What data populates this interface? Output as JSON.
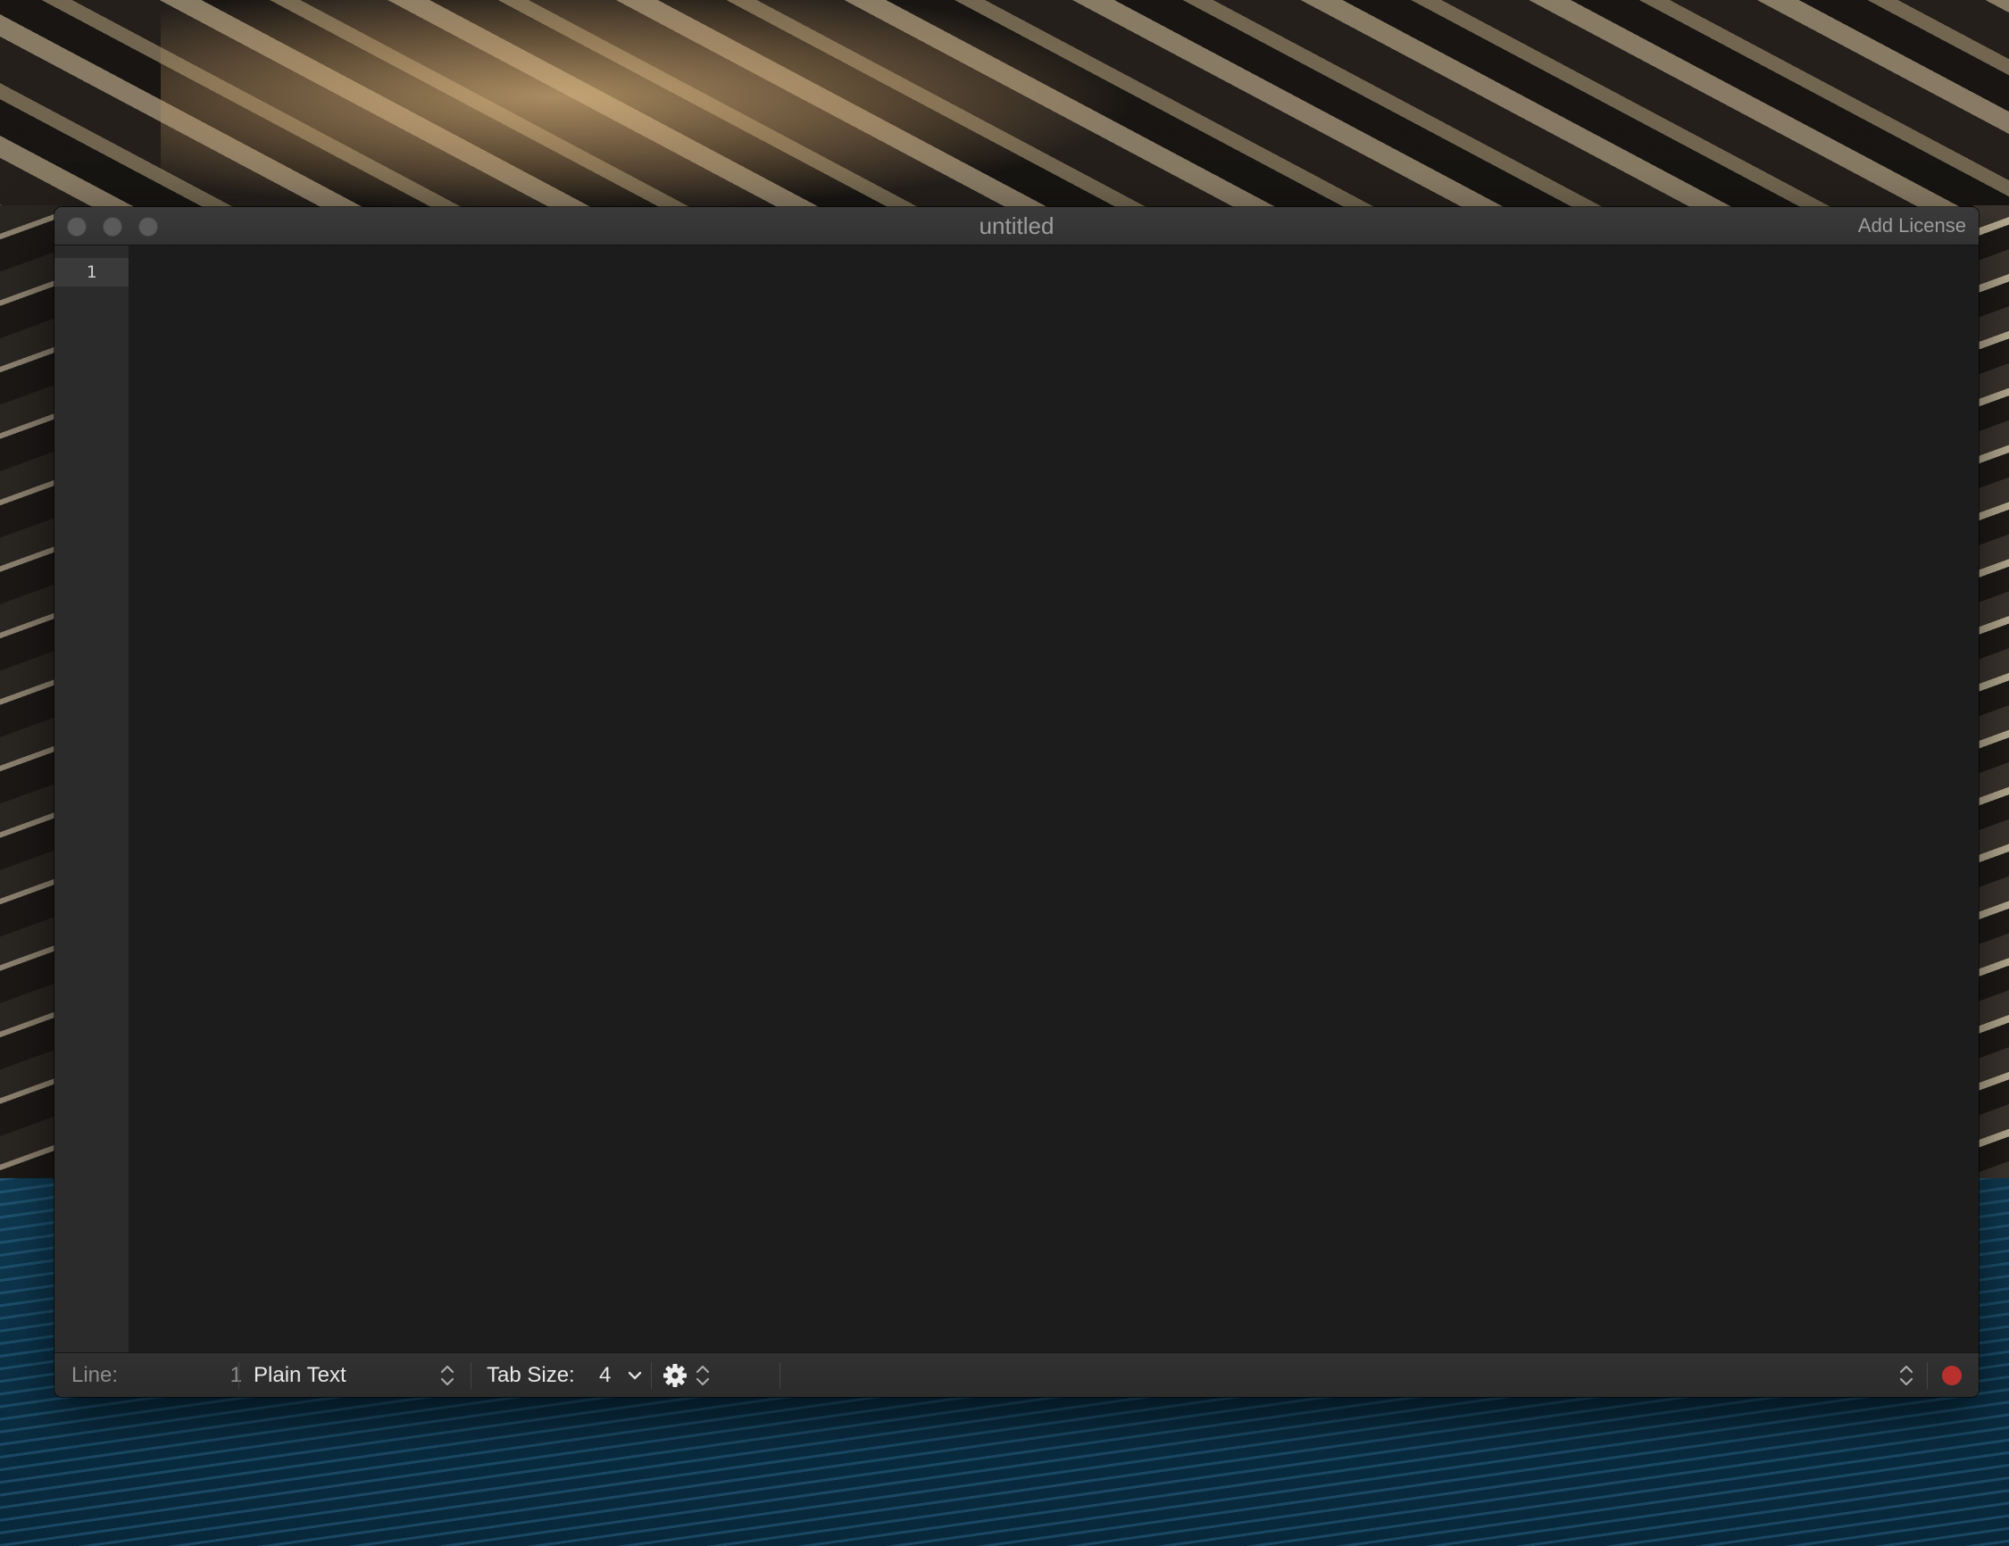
{
  "window": {
    "title": "untitled",
    "add_license_label": "Add License",
    "traffic_lights": [
      "close",
      "minimize",
      "zoom"
    ]
  },
  "editor": {
    "line_numbers": [
      "1"
    ],
    "content": ""
  },
  "statusbar": {
    "line_label": "Line:",
    "line_value": "1",
    "syntax": "Plain Text",
    "tab_size_label": "Tab Size:",
    "tab_size_value": "4",
    "icons": [
      "stepper-icon",
      "chevron-down-icon",
      "gear-icon",
      "stepper-icon",
      "record-icon"
    ]
  },
  "colors": {
    "record_dot": "#b8312f",
    "editor_background": "#1c1c1c",
    "gutter_background": "#2b2b2b"
  }
}
